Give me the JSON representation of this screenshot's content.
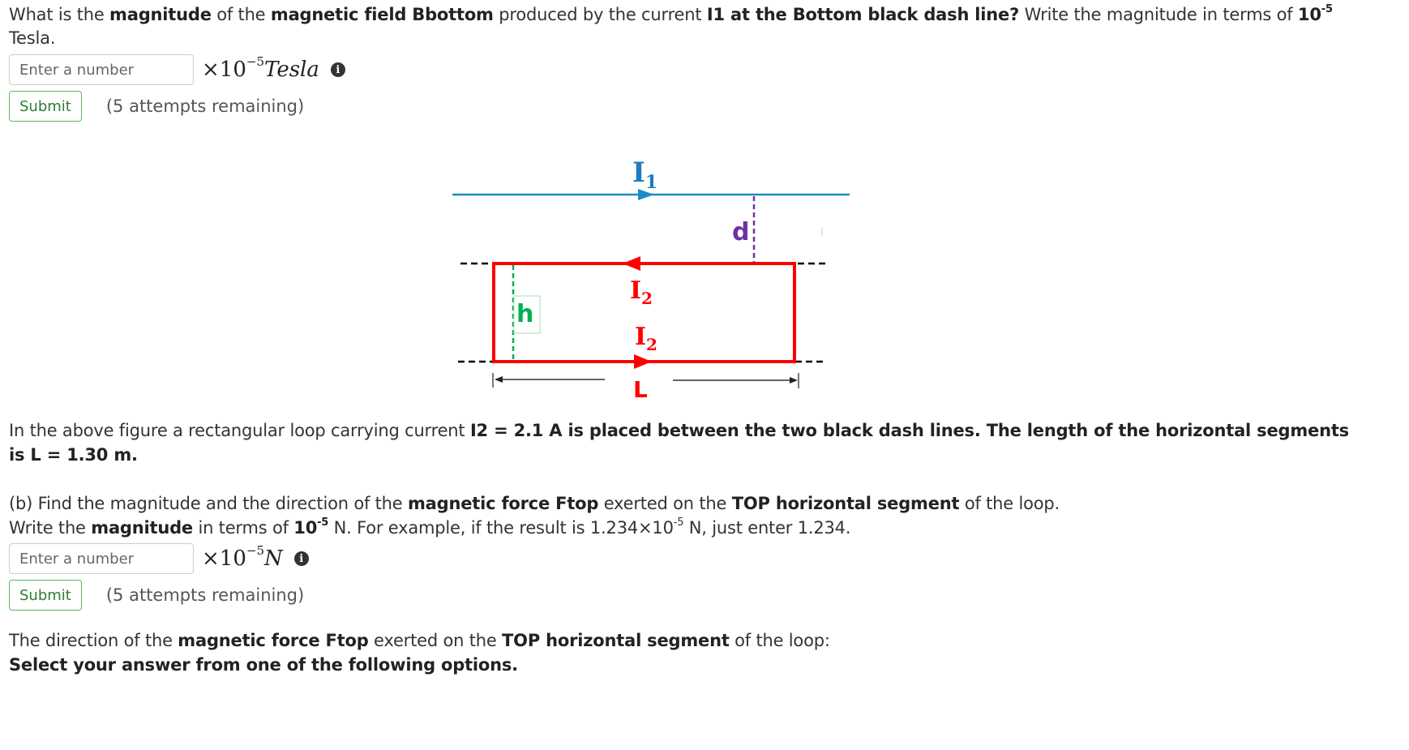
{
  "question_a": {
    "parts": [
      {
        "text": "What is the ",
        "bold": false
      },
      {
        "text": "magnitude",
        "bold": true
      },
      {
        "text": " of the ",
        "bold": false
      },
      {
        "text": "magnetic field Bbottom",
        "bold": true
      },
      {
        "text": " produced by the current ",
        "bold": false
      },
      {
        "text": "I1 at the Bottom black dash line?",
        "bold": true
      },
      {
        "text": " Write the magnitude in terms of ",
        "bold": false
      },
      {
        "text": "10",
        "bold": true
      }
    ],
    "exponent": "-5",
    "line2": "Tesla.",
    "input_placeholder": "Enter a number",
    "unit_prefix": "×10",
    "unit_exponent": "−5",
    "unit_label": "Tesla",
    "submit_label": "Submit",
    "attempts": "(5 attempts remaining)"
  },
  "figure": {
    "label_I1": "I",
    "label_I1_sub": "1",
    "label_I2_top": "I",
    "label_I2_top_sub": "2",
    "label_I2_bottom": "I",
    "label_I2_bottom_sub": "2",
    "label_d": "d",
    "label_h": "h",
    "label_L": "L",
    "colors": {
      "wire_I1": "#1f8ac8",
      "loop": "#ff0000",
      "d_line": "#7030a0",
      "h_line": "#00b050",
      "dash_lines": "#000000"
    }
  },
  "description": {
    "line1_normal": "In  the above figure a rectangular loop carrying current ",
    "line1_bold": "I2 = 2.1 A is placed between the two black dash lines. The length of the horizontal segments",
    "line2_bold": "is L = 1.30 m."
  },
  "question_b": {
    "line1": [
      {
        "text": "(b) Find the magnitude and the direction of the ",
        "bold": false
      },
      {
        "text": "magnetic force Ftop",
        "bold": true
      },
      {
        "text": " exerted on the ",
        "bold": false
      },
      {
        "text": "TOP horizontal segment",
        "bold": true
      },
      {
        "text": " of the loop.",
        "bold": false
      }
    ],
    "line2_a": "Write the ",
    "line2_b": "magnitude",
    "line2_c": " in terms of ",
    "line2_d": "10",
    "line2_exp": "-5",
    "line2_e": " N. For example, if the result is 1.234×10",
    "line2_exp2": "-5",
    "line2_f": " N, just enter 1.234.",
    "input_placeholder": "Enter a number",
    "unit_prefix": "×10",
    "unit_exponent": "−5",
    "unit_label": "N",
    "submit_label": "Submit",
    "attempts": "(5 attempts remaining)"
  },
  "direction_prompt": {
    "line1": [
      {
        "text": "The direction of the ",
        "bold": false
      },
      {
        "text": "magnetic force Ftop",
        "bold": true
      },
      {
        "text": " exerted on the ",
        "bold": false
      },
      {
        "text": "TOP horizontal segment",
        "bold": true
      },
      {
        "text": " of the loop:",
        "bold": false
      }
    ],
    "line2": "Select your answer from one of the following options."
  }
}
